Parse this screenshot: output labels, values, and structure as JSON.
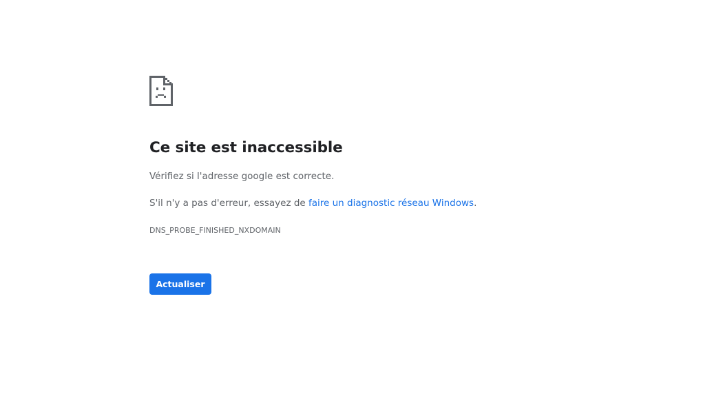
{
  "icon": "sad-page-icon",
  "title": "Ce site est inaccessible",
  "suggestion": "Vérifiez si l'adresse google est correcte.",
  "diagnostic": {
    "prefix": "S'il n'y a pas d'erreur, essayez de ",
    "link": "faire un diagnostic réseau Windows",
    "suffix": "."
  },
  "error_code": "DNS_PROBE_FINISHED_NXDOMAIN",
  "reload_label": "Actualiser",
  "colors": {
    "link": "#1a73e8",
    "button": "#1a73e8",
    "icon": "#5f6368"
  }
}
